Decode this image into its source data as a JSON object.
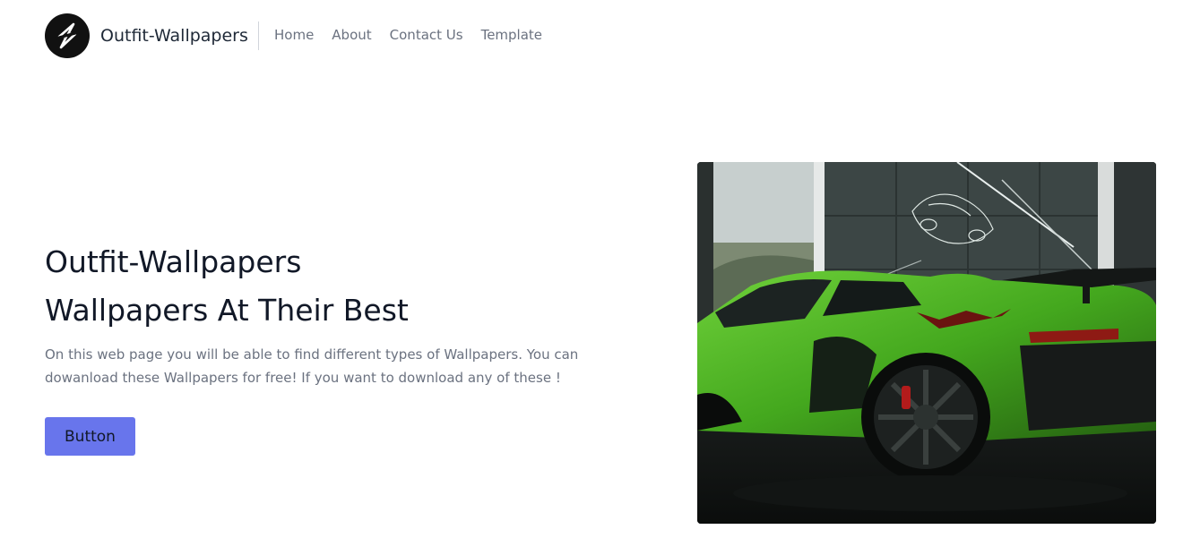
{
  "brand": {
    "name": "Outfit-Wallpapers",
    "logo_icon": "lightning-bolt-icon",
    "logo_color": "#111111"
  },
  "nav": {
    "items": [
      {
        "label": "Home"
      },
      {
        "label": "About"
      },
      {
        "label": "Contact Us"
      },
      {
        "label": "Template"
      }
    ]
  },
  "hero": {
    "title_line1": "Outfit-Wallpapers",
    "title_line2": "Wallpapers At Their Best",
    "description": "On this web page you will be able to find different types of Wallpapers. You can dowanload these Wallpapers for free! If you want to download any of these !",
    "button_label": "Button",
    "button_color": "#6875ec",
    "image_subject": "green sports car in showroom"
  }
}
